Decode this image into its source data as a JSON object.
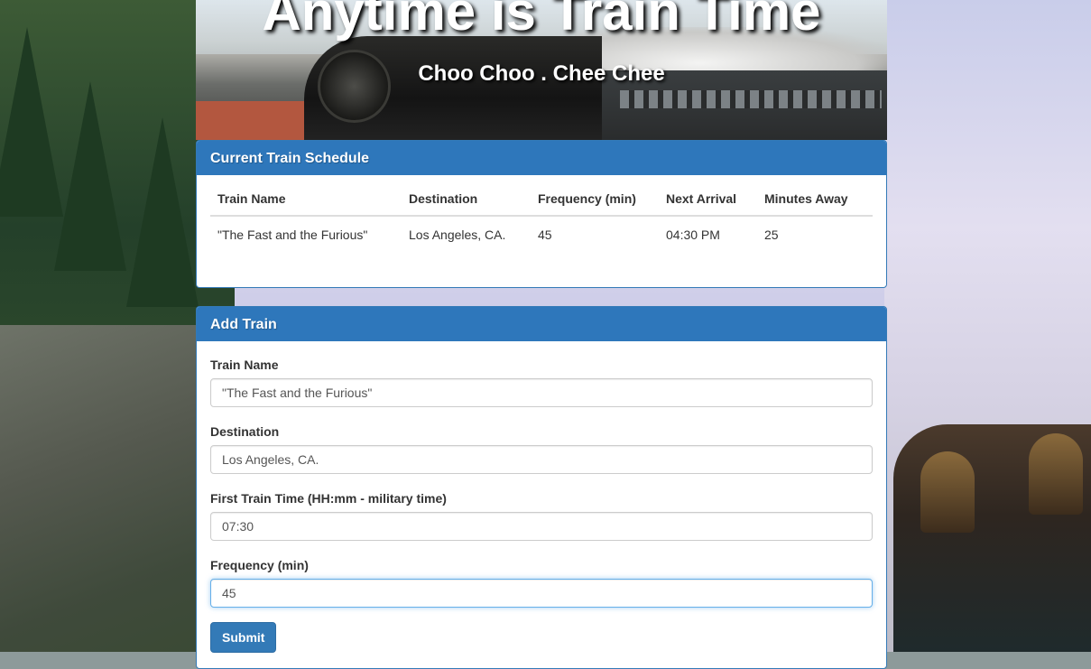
{
  "header": {
    "title": "Anytime is Train Time",
    "subtitle": "Choo Choo . Chee Chee"
  },
  "schedule": {
    "heading": "Current Train Schedule",
    "columns": [
      "Train Name",
      "Destination",
      "Frequency (min)",
      "Next Arrival",
      "Minutes Away"
    ],
    "rows": [
      [
        "\"The Fast and the Furious\"",
        "Los Angeles, CA.",
        "45",
        "04:30 PM",
        "25"
      ]
    ]
  },
  "add_train": {
    "heading": "Add Train",
    "fields": [
      {
        "label": "Train Name",
        "value": "\"The Fast and the Furious\""
      },
      {
        "label": "Destination",
        "value": "Los Angeles, CA."
      },
      {
        "label": "First Train Time (HH:mm - military time)",
        "value": "07:30"
      },
      {
        "label": "Frequency (min)",
        "value": "45"
      }
    ],
    "submit_label": "Submit"
  },
  "colors": {
    "panel_heading": "#2e77bb",
    "button": "#337ab7"
  }
}
